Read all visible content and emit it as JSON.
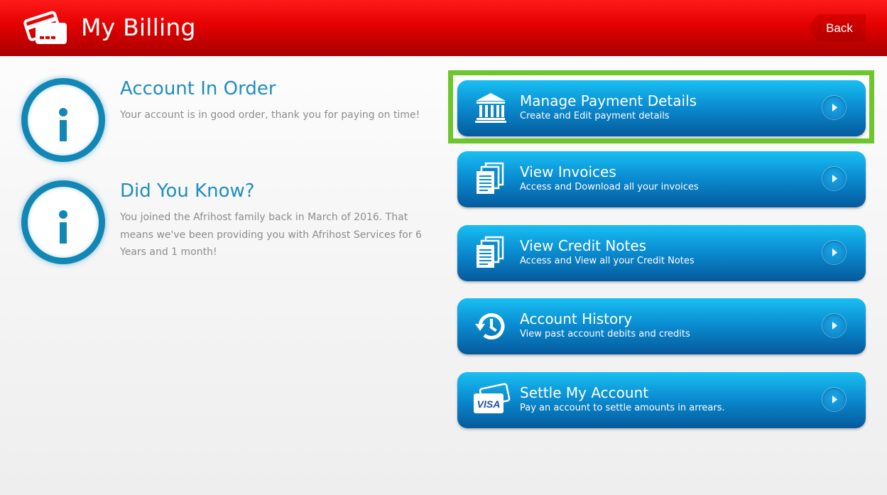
{
  "header": {
    "title": "My Billing",
    "back_label": "Back",
    "icon": "credit-cards-icon"
  },
  "info": [
    {
      "title": "Account In Order",
      "text": "Your account is in good order, thank you for paying on time!",
      "icon": "info-icon"
    },
    {
      "title": "Did You Know?",
      "text": "You joined the Afrihost family back in March of 2016. That means we've been providing you with Afrihost Services for 6 Years and 1 month!",
      "icon": "info-icon"
    }
  ],
  "menu": [
    {
      "title": "Manage Payment Details",
      "subtitle": "Create and Edit payment details",
      "icon": "bank-icon",
      "selected": true
    },
    {
      "title": "View Invoices",
      "subtitle": "Access and Download all your invoices",
      "icon": "documents-icon"
    },
    {
      "title": "View Credit Notes",
      "subtitle": "Access and View all your Credit Notes",
      "icon": "documents-icon"
    },
    {
      "title": "Account History",
      "subtitle": "View past account debits and credits",
      "icon": "history-icon"
    },
    {
      "title": "Settle My Account",
      "subtitle": "Pay an account to settle amounts in arrears.",
      "icon": "visa-card-icon",
      "icon_text": "VISA"
    }
  ],
  "colors": {
    "header_red": "#e30000",
    "accent_blue": "#1f8ec0",
    "button_blue": "#0a8bd0",
    "highlight_green": "#6cc62c",
    "text_gray": "#8c8c8c"
  }
}
